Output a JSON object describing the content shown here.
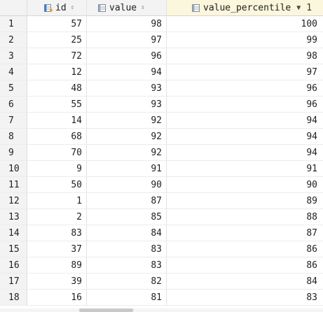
{
  "columns": [
    {
      "label": "id",
      "icon": "key-column-icon",
      "sort": "sort-neutral-icon"
    },
    {
      "label": "value",
      "icon": "column-icon",
      "sort": "sort-neutral-icon"
    },
    {
      "label": "value_percentile",
      "icon": "column-icon",
      "sort": "sort-desc-icon",
      "sort_order": "1"
    }
  ],
  "sort_glyphs": {
    "neutral": "⇕",
    "desc": "▼"
  },
  "rows": [
    {
      "n": "1",
      "id": "57",
      "value": "98",
      "pct": "100"
    },
    {
      "n": "2",
      "id": "25",
      "value": "97",
      "pct": "99"
    },
    {
      "n": "3",
      "id": "72",
      "value": "96",
      "pct": "98"
    },
    {
      "n": "4",
      "id": "12",
      "value": "94",
      "pct": "97"
    },
    {
      "n": "5",
      "id": "48",
      "value": "93",
      "pct": "96"
    },
    {
      "n": "6",
      "id": "55",
      "value": "93",
      "pct": "96"
    },
    {
      "n": "7",
      "id": "14",
      "value": "92",
      "pct": "94"
    },
    {
      "n": "8",
      "id": "68",
      "value": "92",
      "pct": "94"
    },
    {
      "n": "9",
      "id": "70",
      "value": "92",
      "pct": "94"
    },
    {
      "n": "10",
      "id": "9",
      "value": "91",
      "pct": "91"
    },
    {
      "n": "11",
      "id": "50",
      "value": "90",
      "pct": "90"
    },
    {
      "n": "12",
      "id": "1",
      "value": "87",
      "pct": "89"
    },
    {
      "n": "13",
      "id": "2",
      "value": "85",
      "pct": "88"
    },
    {
      "n": "14",
      "id": "83",
      "value": "84",
      "pct": "87"
    },
    {
      "n": "15",
      "id": "37",
      "value": "83",
      "pct": "86"
    },
    {
      "n": "16",
      "id": "89",
      "value": "83",
      "pct": "86"
    },
    {
      "n": "17",
      "id": "39",
      "value": "82",
      "pct": "84"
    },
    {
      "n": "18",
      "id": "16",
      "value": "81",
      "pct": "83"
    }
  ]
}
